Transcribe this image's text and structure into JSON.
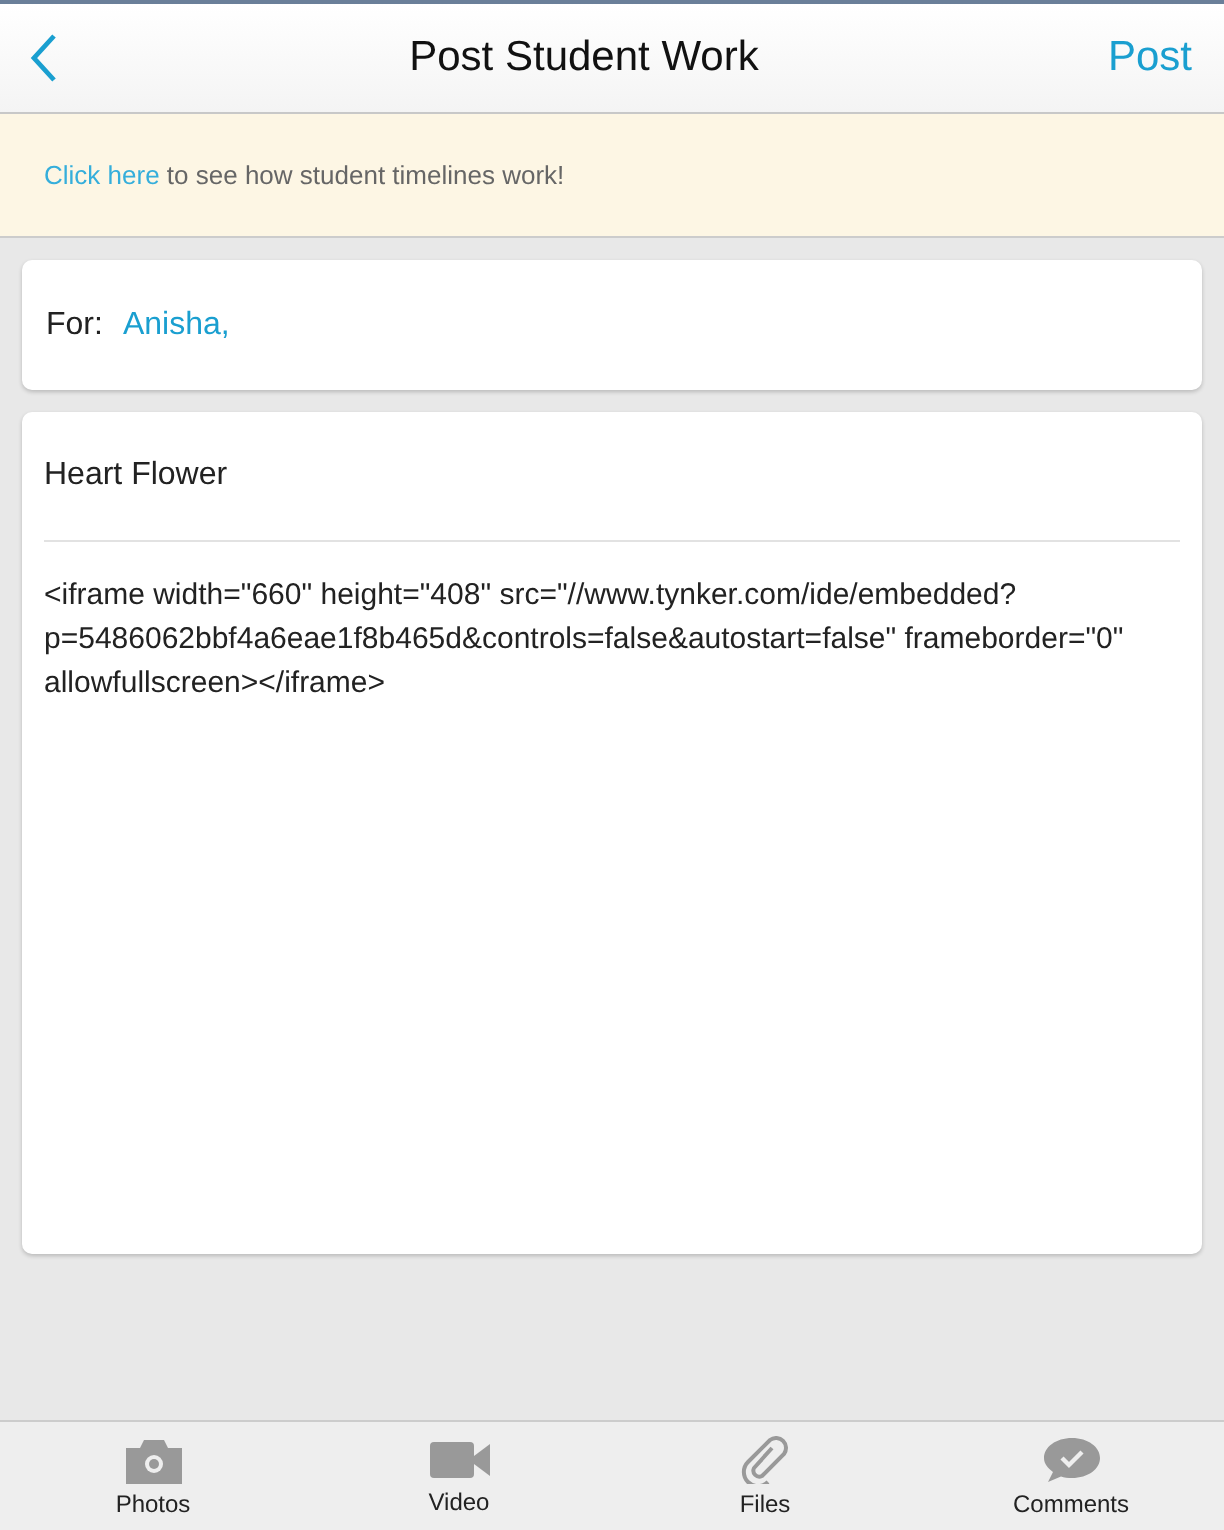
{
  "header": {
    "title": "Post Student Work",
    "action": "Post"
  },
  "banner": {
    "link": "Click here",
    "text": "to see how student timelines work!"
  },
  "recipients": {
    "label": "For:",
    "names": "Anisha,"
  },
  "post": {
    "title": "Heart Flower",
    "body": "<iframe width=\"660\" height=\"408\" src=\"//www.tynker.com/ide/embedded?p=5486062bbf4a6eae1f8b465d&controls=false&autostart=false\" frameborder=\"0\" allowfullscreen></iframe>"
  },
  "toolbar": [
    {
      "kind": "camera",
      "label": "Photos"
    },
    {
      "kind": "video",
      "label": "Video"
    },
    {
      "kind": "clip",
      "label": "Files"
    },
    {
      "kind": "comment",
      "label": "Comments"
    }
  ]
}
